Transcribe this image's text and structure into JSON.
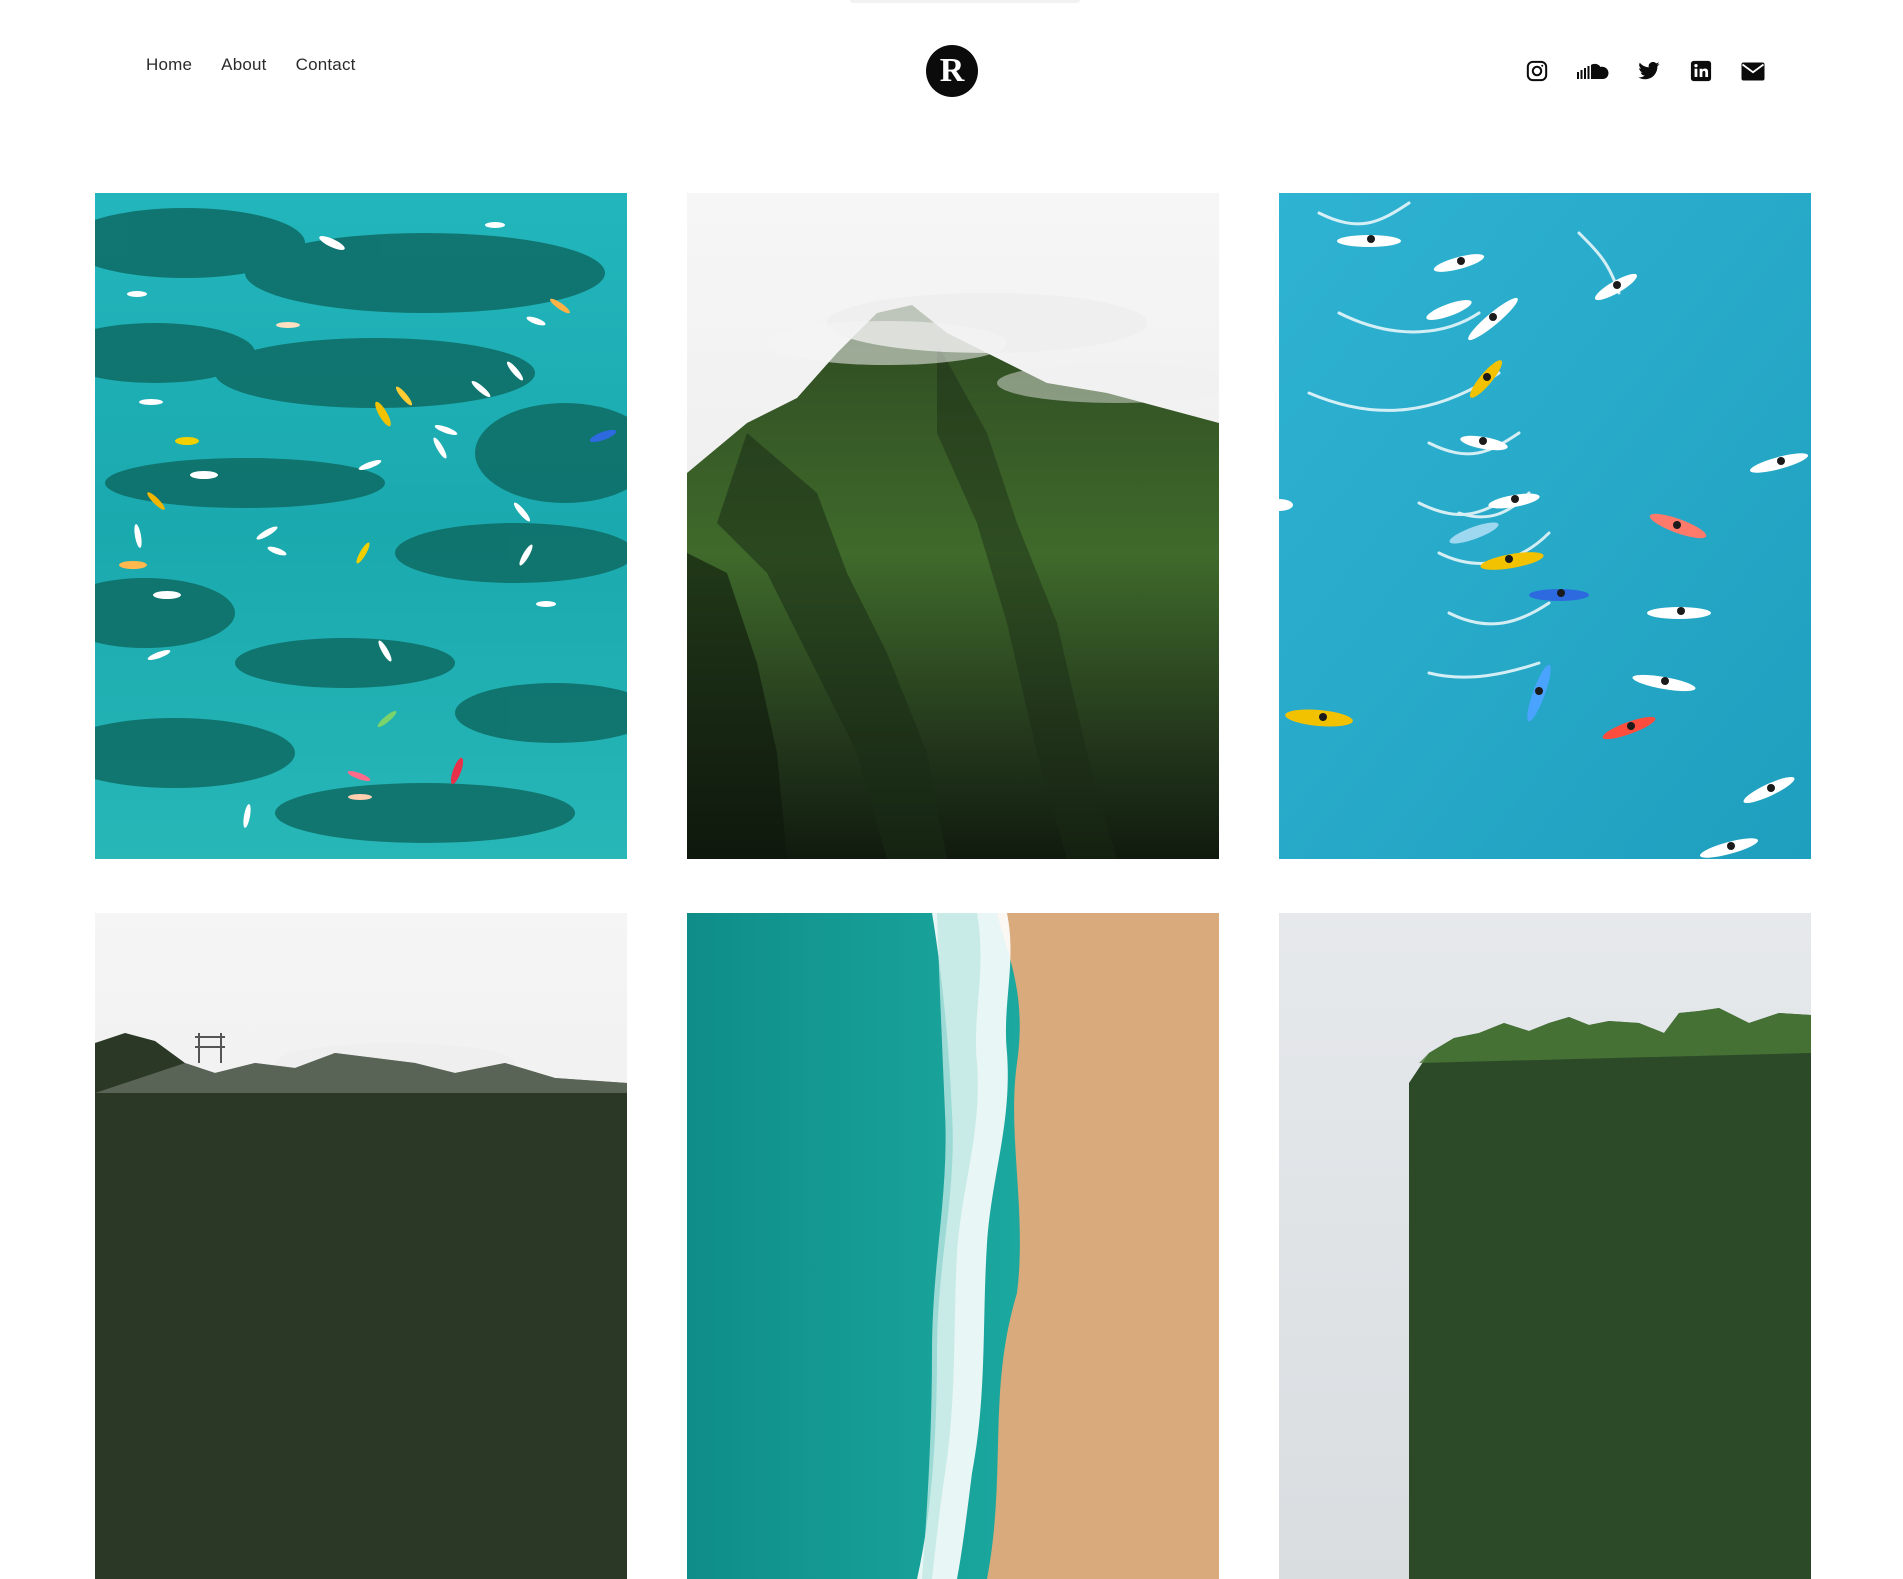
{
  "nav": {
    "items": [
      {
        "label": "Home"
      },
      {
        "label": "About"
      },
      {
        "label": "Contact"
      }
    ]
  },
  "logo": {
    "letter": "R",
    "icon": "r-logo-icon",
    "color": "#0b0b0b"
  },
  "social": [
    {
      "icon": "instagram-icon"
    },
    {
      "icon": "soundcloud-icon"
    },
    {
      "icon": "twitter-icon"
    },
    {
      "icon": "linkedin-icon"
    },
    {
      "icon": "email-icon"
    }
  ],
  "gallery": {
    "tiles": [
      {
        "subject": "aerial-surfers-reef",
        "colors": [
          "#1fb3b8",
          "#0f6f6a"
        ]
      },
      {
        "subject": "misty-green-mountain",
        "colors": [
          "#f4f4f4",
          "#3c5f24"
        ]
      },
      {
        "subject": "aerial-surfers-blue",
        "colors": [
          "#23a6c7",
          "#2fb6d6"
        ]
      },
      {
        "subject": "misty-hills-horizon",
        "colors": [
          "#f2f2f2",
          "#1f2a1d"
        ]
      },
      {
        "subject": "aerial-beach-shore",
        "colors": [
          "#17a7a0",
          "#d8aa7c"
        ]
      },
      {
        "subject": "green-ridge-sky",
        "colors": [
          "#e9ebed",
          "#2b4a25"
        ]
      }
    ]
  }
}
